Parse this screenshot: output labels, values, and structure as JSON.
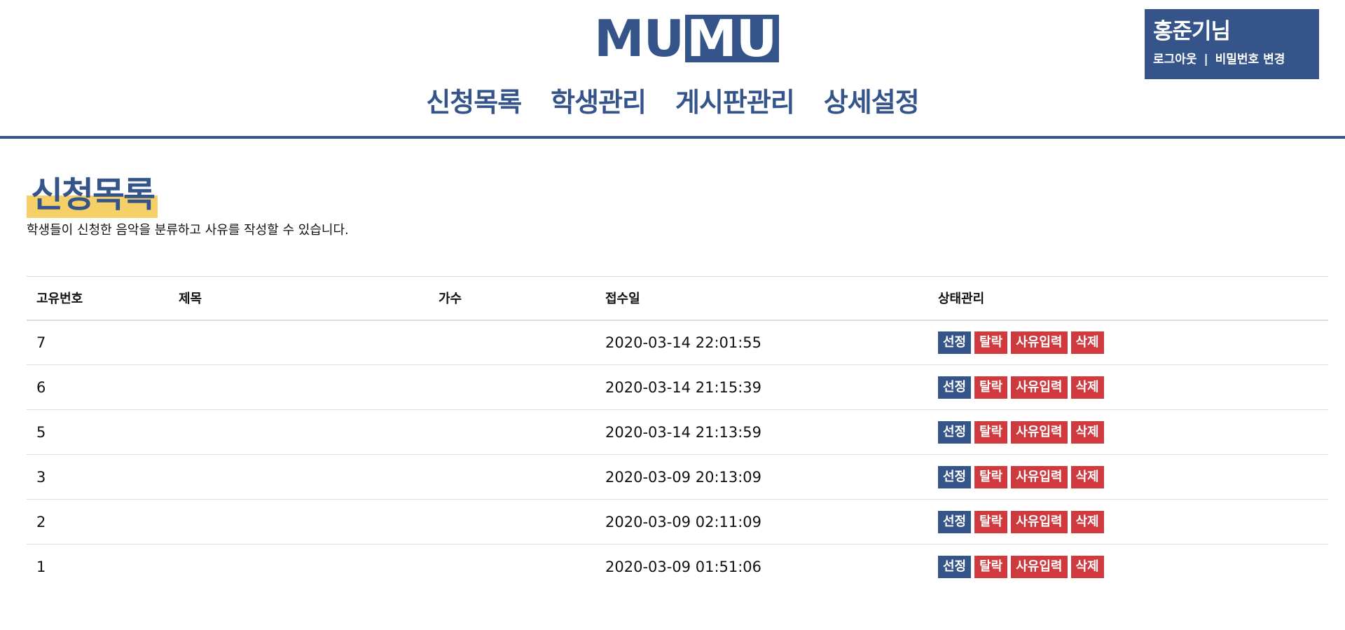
{
  "header": {
    "logo_left": "MU",
    "logo_right": "MU",
    "nav": [
      {
        "label": "신청목록"
      },
      {
        "label": "학생관리"
      },
      {
        "label": "게시판관리"
      },
      {
        "label": "상세설정"
      }
    ]
  },
  "user": {
    "name": "홍준기님",
    "logout": "로그아웃",
    "separator": "|",
    "change_password": "비밀번호 변경"
  },
  "page": {
    "title": "신청목록",
    "description": "학생들이 신청한 음악을 분류하고 사유를 작성할 수 있습니다."
  },
  "table": {
    "columns": [
      "고유번호",
      "제목",
      "가수",
      "접수일",
      "상태관리"
    ],
    "rows": [
      {
        "id": "7",
        "title": "",
        "singer": "",
        "date": "2020-03-14 22:01:55"
      },
      {
        "id": "6",
        "title": "",
        "singer": "",
        "date": "2020-03-14 21:15:39"
      },
      {
        "id": "5",
        "title": "",
        "singer": "",
        "date": "2020-03-14 21:13:59"
      },
      {
        "id": "3",
        "title": "",
        "singer": "",
        "date": "2020-03-09 20:13:09"
      },
      {
        "id": "2",
        "title": "",
        "singer": "",
        "date": "2020-03-09 02:11:09"
      },
      {
        "id": "1",
        "title": "",
        "singer": "",
        "date": "2020-03-09 01:51:06"
      }
    ],
    "actions": {
      "select": "선정",
      "drop": "탈락",
      "reason": "사유입력",
      "delete": "삭제"
    }
  },
  "colors": {
    "primary": "#34548a",
    "danger": "#d0393e",
    "highlight": "#f5cf67"
  }
}
